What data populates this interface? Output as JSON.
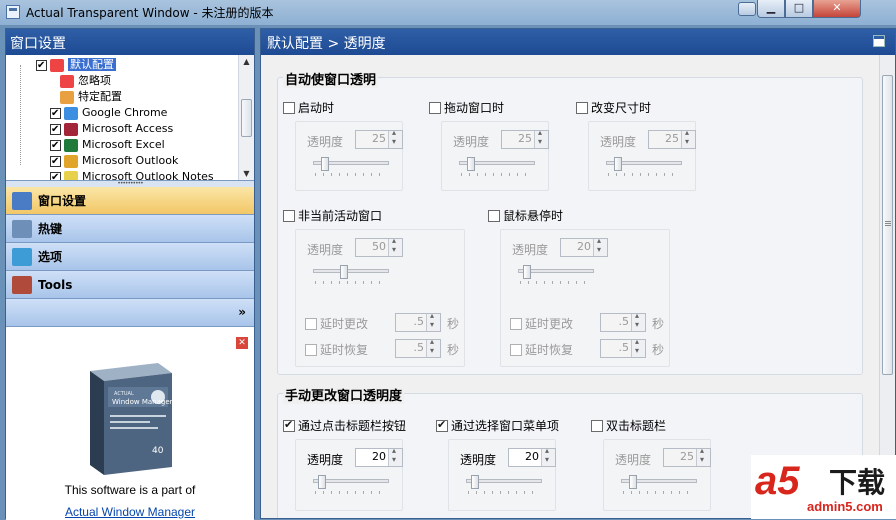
{
  "window": {
    "title": "Actual Transparent Window - 未注册的版本"
  },
  "left": {
    "header": "窗口设置",
    "tree": [
      {
        "label": "默认配置",
        "checked": true,
        "selected": true,
        "color": "#e44"
      },
      {
        "label": "忽略项",
        "checked": false,
        "selected": false,
        "color": "#e44"
      },
      {
        "label": "特定配置",
        "checked": false,
        "selected": false,
        "color": "#e8a040"
      },
      {
        "label": "Google Chrome",
        "checked": true,
        "selected": false,
        "color": "#3b8ee0"
      },
      {
        "label": "Microsoft Access",
        "checked": true,
        "selected": false,
        "color": "#a3253a"
      },
      {
        "label": "Microsoft Excel",
        "checked": true,
        "selected": false,
        "color": "#1f7a3b"
      },
      {
        "label": "Microsoft Outlook",
        "checked": true,
        "selected": false,
        "color": "#e0a52a"
      },
      {
        "label": "Microsoft Outlook Notes",
        "checked": true,
        "selected": false,
        "color": "#e8d14a"
      }
    ],
    "nav": [
      {
        "label": "窗口设置",
        "active": true,
        "icon": "window-settings-icon"
      },
      {
        "label": "热键",
        "active": false,
        "icon": "keyboard-icon"
      },
      {
        "label": "选项",
        "active": false,
        "icon": "options-icon"
      },
      {
        "label": "Tools",
        "active": false,
        "icon": "tools-icon"
      }
    ],
    "nav_more": "»",
    "promo": {
      "text": "This software is a part of",
      "link": "Actual Window Manager",
      "box_title": "Window Manager",
      "box_brand": "ACTUAL",
      "box_badge": "40"
    }
  },
  "right": {
    "header": "默认配置 > 透明度",
    "auto": {
      "title": "自动使窗口透明",
      "items": [
        {
          "label": "启动时",
          "checked": false,
          "opacity_label": "透明度",
          "opacity": "25",
          "slider": 0.12
        },
        {
          "label": "拖动窗口时",
          "checked": false,
          "opacity_label": "透明度",
          "opacity": "25",
          "slider": 0.12
        },
        {
          "label": "改变尺寸时",
          "checked": false,
          "opacity_label": "透明度",
          "opacity": "25",
          "slider": 0.12
        },
        {
          "label": "非当前活动窗口",
          "checked": false,
          "opacity_label": "透明度",
          "opacity": "50",
          "slider": 0.4,
          "delay_on": "延时更改",
          "delay_on_val": ".5",
          "delay_off": "延时恢复",
          "delay_off_val": ".5",
          "unit": "秒"
        },
        {
          "label": "鼠标悬停时",
          "checked": false,
          "opacity_label": "透明度",
          "opacity": "20",
          "slider": 0.08,
          "delay_on": "延时更改",
          "delay_on_val": ".5",
          "delay_off": "延时恢复",
          "delay_off_val": ".5",
          "unit": "秒"
        }
      ]
    },
    "manual": {
      "title": "手动更改窗口透明度",
      "items": [
        {
          "label": "通过点击标题栏按钮",
          "checked": true,
          "opacity_label": "透明度",
          "opacity": "20",
          "slider": 0.08
        },
        {
          "label": "通过选择窗口菜单项",
          "checked": true,
          "opacity_label": "透明度",
          "opacity": "20",
          "slider": 0.08
        },
        {
          "label": "双击标题栏",
          "checked": false,
          "opacity_label": "透明度",
          "opacity": "25",
          "slider": 0.12
        }
      ]
    }
  },
  "watermark": {
    "logo": "a5",
    "text": "下载",
    "url": "admin5.com"
  }
}
